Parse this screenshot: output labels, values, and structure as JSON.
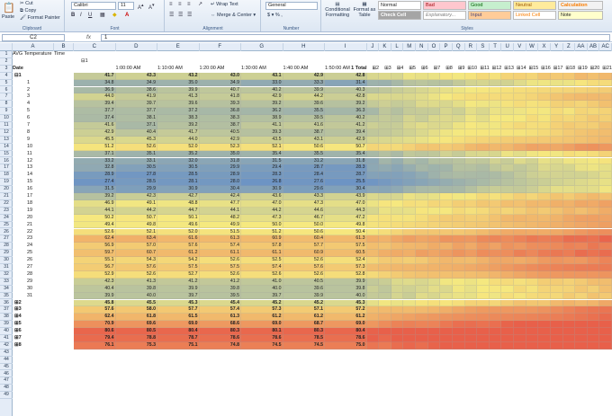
{
  "ribbon": {
    "clipboard": {
      "label": "Clipboard",
      "paste": "Paste",
      "cut": "Cut",
      "copy": "Copy",
      "format_painter": "Format Painter"
    },
    "font": {
      "label": "Font",
      "name": "Calibri",
      "size": "11"
    },
    "alignment": {
      "label": "Alignment",
      "wrap_text": "Wrap Text",
      "merge_center": "Merge & Center"
    },
    "number": {
      "label": "Number",
      "format": "General",
      "symbols": "$ ▾ % ,"
    },
    "styles": {
      "label": "Styles",
      "conditional_formatting": "Conditional Formatting",
      "format_as_table": "Format as Table",
      "cells": [
        "Normal",
        "Bad",
        "Good",
        "Neutral",
        "Calculation",
        "Check Cell",
        "Explanatory...",
        "Input",
        "Linked Cell",
        "Note"
      ]
    }
  },
  "formula_bar": {
    "name_box": "C2",
    "fx": "fx",
    "value": "1"
  },
  "sheet": {
    "columns": [
      "A",
      "B",
      "C",
      "D",
      "E",
      "F",
      "G",
      "H",
      "I",
      "J",
      "K",
      "L",
      "M",
      "N",
      "O",
      "P",
      "Q",
      "R",
      "S",
      "T",
      "U",
      "V",
      "W",
      "X",
      "Y",
      "Z",
      "AA",
      "AB",
      "AC"
    ],
    "row_numbers": [
      "1",
      "2",
      "3",
      "4",
      "5",
      "6",
      "7",
      "8",
      "9",
      "10",
      "11",
      "12",
      "13",
      "14",
      "15",
      "16",
      "17",
      "18",
      "19",
      "20",
      "21",
      "22",
      "23",
      "24",
      "25",
      "26",
      "27",
      "28",
      "29",
      "30",
      "31",
      "32",
      "33",
      "34",
      "35",
      "36",
      "37",
      "38",
      "39",
      "40",
      "41",
      "42",
      "43",
      "44",
      "45",
      "46",
      "47",
      "48",
      "49"
    ],
    "pivot_title": "AVG Temperature",
    "time_label": "Time",
    "date_label": "Date",
    "group_1": "1",
    "hour_headers": [
      "1:00:00 AM",
      "1:10:00 AM",
      "1:20:00 AM",
      "1:30:00 AM",
      "1:40:00 AM",
      "1:50:00 AM"
    ],
    "total_label": "1 Total",
    "group_headers": [
      "2",
      "3",
      "4",
      "5",
      "6",
      "7",
      "8",
      "9",
      "10",
      "11",
      "12",
      "13",
      "14",
      "15",
      "16",
      "17",
      "18",
      "19",
      "20",
      "21"
    ],
    "month_rows": [
      {
        "label": "1",
        "values": [
          "41.7",
          "43.3",
          "43.2",
          "43.0",
          "43.1",
          "42.9",
          "42.8"
        ]
      },
      {
        "label": "2",
        "values": [
          "45.8",
          "45.5",
          "45.3",
          "45.4",
          "45.2",
          "45.2",
          "45.3"
        ]
      },
      {
        "label": "3",
        "values": [
          "57.6",
          "58.0",
          "57.7",
          "57.4",
          "57.3",
          "57.1",
          "57.2"
        ]
      },
      {
        "label": "4",
        "values": [
          "62.4",
          "61.8",
          "61.5",
          "61.3",
          "61.2",
          "61.2",
          "61.2"
        ]
      },
      {
        "label": "5",
        "values": [
          "70.9",
          "69.6",
          "69.0",
          "68.6",
          "69.0",
          "68.7",
          "69.0"
        ]
      },
      {
        "label": "6",
        "values": [
          "80.6",
          "80.5",
          "80.4",
          "80.3",
          "80.1",
          "80.3",
          "80.4"
        ]
      },
      {
        "label": "7",
        "values": [
          "79.4",
          "78.8",
          "78.7",
          "78.6",
          "78.6",
          "78.5",
          "78.6"
        ]
      },
      {
        "label": "8",
        "values": [
          "76.1",
          "75.3",
          "75.1",
          "74.8",
          "74.5",
          "74.5",
          "75.0"
        ]
      }
    ],
    "day_rows": [
      {
        "label": "1",
        "values": [
          "34.8",
          "34.9",
          "35.0",
          "34.9",
          "33.0",
          "33.3",
          "31.4"
        ]
      },
      {
        "label": "2",
        "values": [
          "36.9",
          "38.6",
          "39.9",
          "40.7",
          "40.2",
          "39.9",
          "40.3"
        ]
      },
      {
        "label": "3",
        "values": [
          "44.0",
          "41.9",
          "41.3",
          "41.8",
          "42.9",
          "44.2",
          "42.8"
        ]
      },
      {
        "label": "4",
        "values": [
          "39.4",
          "39.7",
          "39.6",
          "39.3",
          "39.2",
          "39.6",
          "39.2"
        ]
      },
      {
        "label": "5",
        "values": [
          "37.7",
          "37.7",
          "37.2",
          "36.8",
          "36.2",
          "35.5",
          "36.3"
        ]
      },
      {
        "label": "6",
        "values": [
          "37.4",
          "38.1",
          "38.3",
          "38.3",
          "38.9",
          "39.5",
          "40.2"
        ]
      },
      {
        "label": "7",
        "values": [
          "41.6",
          "37.1",
          "39.2",
          "38.7",
          "41.1",
          "41.6",
          "41.2"
        ]
      },
      {
        "label": "8",
        "values": [
          "42.9",
          "40.4",
          "41.7",
          "40.5",
          "39.3",
          "38.7",
          "39.4"
        ]
      },
      {
        "label": "9",
        "values": [
          "45.5",
          "45.3",
          "44.0",
          "42.9",
          "43.5",
          "43.1",
          "42.9"
        ]
      },
      {
        "label": "10",
        "values": [
          "51.2",
          "52.6",
          "52.0",
          "52.3",
          "52.1",
          "50.6",
          "50.7"
        ]
      },
      {
        "label": "11",
        "values": [
          "37.1",
          "35.1",
          "35.2",
          "35.0",
          "35.4",
          "35.5",
          "35.4"
        ]
      },
      {
        "label": "12",
        "values": [
          "33.2",
          "33.1",
          "32.0",
          "31.8",
          "31.5",
          "31.2",
          "31.8"
        ]
      },
      {
        "label": "13",
        "values": [
          "32.8",
          "30.5",
          "30.5",
          "29.9",
          "29.4",
          "28.7",
          "28.3"
        ]
      },
      {
        "label": "14",
        "values": [
          "28.9",
          "27.8",
          "28.5",
          "28.9",
          "28.3",
          "28.4",
          "28.7"
        ]
      },
      {
        "label": "15",
        "values": [
          "27.4",
          "28.5",
          "28.1",
          "28.0",
          "26.8",
          "27.6",
          "25.5"
        ]
      },
      {
        "label": "16",
        "values": [
          "31.5",
          "29.9",
          "30.9",
          "30.4",
          "30.9",
          "29.6",
          "30.4"
        ]
      },
      {
        "label": "17",
        "values": [
          "39.2",
          "42.3",
          "42.7",
          "42.4",
          "43.6",
          "43.3",
          "43.9"
        ]
      },
      {
        "label": "18",
        "values": [
          "46.9",
          "49.1",
          "48.8",
          "47.7",
          "47.0",
          "47.3",
          "47.0"
        ]
      },
      {
        "label": "19",
        "values": [
          "44.1",
          "44.2",
          "44.7",
          "44.1",
          "44.2",
          "44.6",
          "44.3"
        ]
      },
      {
        "label": "20",
        "values": [
          "50.2",
          "50.7",
          "50.1",
          "48.2",
          "47.3",
          "46.7",
          "47.2"
        ]
      },
      {
        "label": "21",
        "values": [
          "49.4",
          "49.8",
          "49.6",
          "49.9",
          "50.0",
          "50.0",
          "49.8"
        ]
      },
      {
        "label": "22",
        "values": [
          "52.6",
          "52.1",
          "52.0",
          "51.5",
          "51.2",
          "50.6",
          "50.4"
        ]
      },
      {
        "label": "23",
        "values": [
          "62.4",
          "63.4",
          "61.6",
          "61.3",
          "60.9",
          "60.4",
          "61.3"
        ]
      },
      {
        "label": "24",
        "values": [
          "56.9",
          "57.0",
          "57.6",
          "57.4",
          "57.8",
          "57.7",
          "57.5"
        ]
      },
      {
        "label": "25",
        "values": [
          "59.7",
          "60.7",
          "61.2",
          "61.1",
          "61.1",
          "60.9",
          "60.5"
        ]
      },
      {
        "label": "26",
        "values": [
          "55.1",
          "54.3",
          "54.2",
          "52.6",
          "52.5",
          "52.6",
          "52.4"
        ]
      },
      {
        "label": "27",
        "values": [
          "56.7",
          "57.6",
          "57.5",
          "57.5",
          "57.4",
          "57.6",
          "57.3"
        ]
      },
      {
        "label": "28",
        "values": [
          "52.9",
          "52.6",
          "52.7",
          "52.6",
          "52.6",
          "52.6",
          "52.8"
        ]
      },
      {
        "label": "29",
        "values": [
          "42.3",
          "41.3",
          "41.2",
          "41.2",
          "41.0",
          "40.5",
          "39.9"
        ]
      },
      {
        "label": "30",
        "values": [
          "40.4",
          "39.8",
          "39.9",
          "39.8",
          "40.0",
          "39.6",
          "39.8"
        ]
      },
      {
        "label": "31",
        "values": [
          "39.9",
          "40.0",
          "39.7",
          "39.5",
          "39.7",
          "39.9",
          "40.0"
        ]
      }
    ]
  },
  "colors": {
    "cold": "#6d94c4",
    "mid": "#f6e97f",
    "hot": "#e8604a",
    "row_header": "#e4ecf7",
    "ribbon": "#dde7f3"
  }
}
